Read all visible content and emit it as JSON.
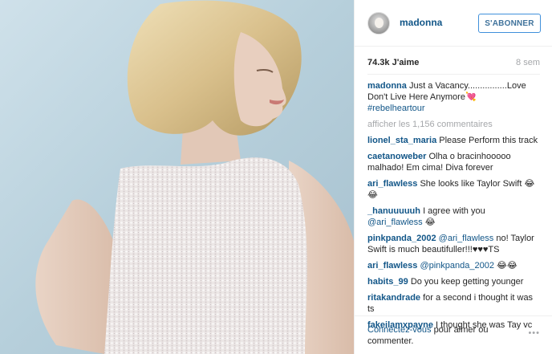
{
  "post": {
    "username": "madonna",
    "follow_label": "S'ABONNER",
    "likes": "74.3k J'aime",
    "time": "8 sem",
    "caption_user": "madonna",
    "caption_text": "Just a Vacancy................Love Don't Live Here Anymore",
    "caption_emoji": "💘",
    "hashtag": "#rebelheartour",
    "show_more": "afficher les 1,156 commentaires"
  },
  "comments": [
    {
      "user": "lionel_sta_maria",
      "parts": [
        {
          "t": "text",
          "v": "Please Perform this track"
        }
      ]
    },
    {
      "user": "caetanoweber",
      "parts": [
        {
          "t": "text",
          "v": "Olha o bracinhooooo malhado! Em cima! Diva forever"
        }
      ]
    },
    {
      "user": "ari_flawless",
      "parts": [
        {
          "t": "text",
          "v": "She looks like Taylor Swift "
        },
        {
          "t": "emoji",
          "v": "😂😂"
        }
      ]
    },
    {
      "user": "_hanuuuuuh",
      "parts": [
        {
          "t": "text",
          "v": "I agree with you "
        },
        {
          "t": "mention",
          "v": "@ari_flawless"
        },
        {
          "t": "text",
          "v": " "
        },
        {
          "t": "emoji",
          "v": "😂"
        }
      ]
    },
    {
      "user": "pinkpanda_2002",
      "parts": [
        {
          "t": "mention",
          "v": "@ari_flawless"
        },
        {
          "t": "text",
          "v": " no! Taylor Swift is much beautifuller!!!♥♥♥TS"
        }
      ]
    },
    {
      "user": "ari_flawless",
      "parts": [
        {
          "t": "mention",
          "v": "@pinkpanda_2002"
        },
        {
          "t": "text",
          "v": " "
        },
        {
          "t": "emoji",
          "v": "😂😂"
        }
      ]
    },
    {
      "user": "habits_99",
      "parts": [
        {
          "t": "text",
          "v": "Do you keep getting younger"
        }
      ]
    },
    {
      "user": "ritakandrade",
      "parts": [
        {
          "t": "text",
          "v": "for a second i thought it was ts"
        }
      ]
    },
    {
      "user": "fakeilamxpayne",
      "parts": [
        {
          "t": "text",
          "v": "I thought she was Tay vc"
        }
      ]
    }
  ],
  "footer": {
    "login_link": "Connectez-vous",
    "login_rest": "pour aimer ou commenter.",
    "more": "•••"
  },
  "icons": {
    "avatar": "profile-avatar",
    "more": "ellipsis-icon"
  },
  "colors": {
    "username_blue": "#125688",
    "follow_border": "#4090db",
    "muted": "#a5a7aa",
    "photo_bg": "#b4cdd9"
  }
}
